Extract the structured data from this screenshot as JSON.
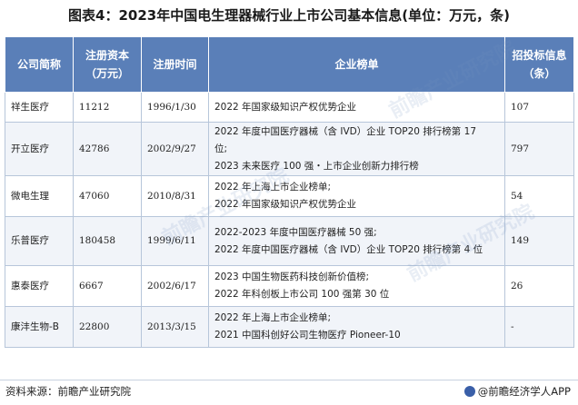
{
  "title": "图表4：2023年中国电生理器械行业上市公司基本信息(单位：万元，条)",
  "headers": {
    "company": "公司简称",
    "capital": "注册资本（万元）",
    "reg_date": "注册时间",
    "rankings": "企业榜单",
    "bids": "招投标信息（条）"
  },
  "rows": [
    {
      "company": "祥生医疗",
      "capital": "11212",
      "reg_date": "1996/1/30",
      "rankings": [
        "2022 年国家级知识产权优势企业"
      ],
      "bids": "107"
    },
    {
      "company": "开立医疗",
      "capital": "42786",
      "reg_date": "2002/9/27",
      "rankings": [
        "2022 年度中国医疗器械（含 IVD）企业 TOP20 排行榜第 17",
        "位;",
        "2023 未来医疗 100 强・上市企业创新力排行榜"
      ],
      "bids": "797"
    },
    {
      "company": "微电生理",
      "capital": "47060",
      "reg_date": "2010/8/31",
      "rankings": [
        "2022 年上海上市企业榜单;",
        "2022 年国家级知识产权优势企业"
      ],
      "bids": "54"
    },
    {
      "company": "乐普医疗",
      "capital": "180458",
      "reg_date": "1999/6/11",
      "rankings": [
        "2022-2023 年度中国医疗器械 50 强;",
        "2022 年度中国医疗器械（含 IVD）企业 TOP20 排行榜第 4 位"
      ],
      "bids": "149"
    },
    {
      "company": "惠泰医疗",
      "capital": "6667",
      "reg_date": "2002/6/17",
      "rankings": [
        "2023 中国生物医药科技创新价值榜;",
        "2022 年科创板上市公司 100 强第 30 位"
      ],
      "bids": "26"
    },
    {
      "company": "康沣生物-B",
      "capital": "22800",
      "reg_date": "2013/3/15",
      "rankings": [
        "2022 年上海上市企业榜单;",
        "2021 中国科创好公司生物医疗 Pioneer-10"
      ],
      "bids": "-"
    }
  ],
  "footer": {
    "source": "资料来源：前瞻产业研究院",
    "brand": "@前瞻经济学人APP"
  }
}
